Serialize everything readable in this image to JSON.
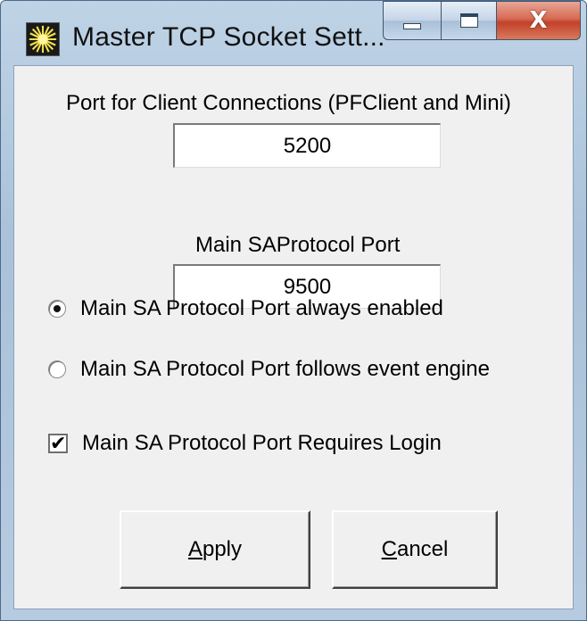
{
  "window": {
    "title": "Master TCP Socket Sett...",
    "icon": "sunburst-app-icon",
    "caption_buttons": {
      "minimize": "minimize-icon",
      "maximize": "maximize-icon",
      "close": "close-icon",
      "close_glyph": "X"
    }
  },
  "client_port": {
    "label": "Port for Client Connections (PFClient and Mini)",
    "value": "5200"
  },
  "main_port": {
    "label": "Main SAProtocol Port",
    "value": "9500"
  },
  "port_mode": {
    "options": [
      {
        "label": "Main SA Protocol Port always enabled",
        "selected": true
      },
      {
        "label": "Main SA Protocol Port follows event engine",
        "selected": false
      }
    ]
  },
  "requires_login": {
    "label": "Main SA Protocol Port Requires Login",
    "checked": true,
    "check_glyph": "✔"
  },
  "buttons": {
    "apply": {
      "accel": "A",
      "rest": "pply"
    },
    "cancel": {
      "accel": "C",
      "rest": "ancel"
    }
  },
  "colors": {
    "frame": "#b7cbe0",
    "client_bg": "#f0f0f0",
    "close_button": "#c2412a"
  }
}
